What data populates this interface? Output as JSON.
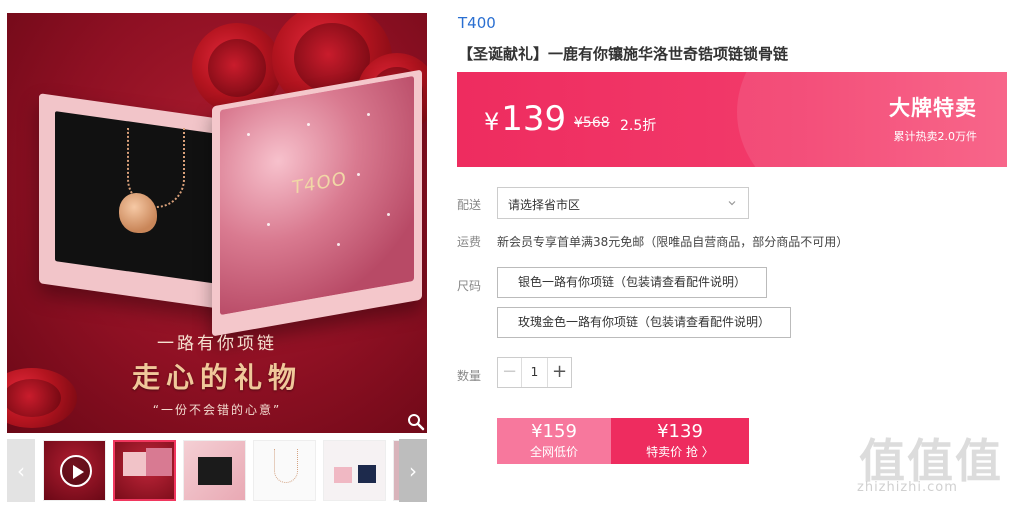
{
  "product": {
    "brand": "T400",
    "title": "【圣诞献礼】一鹿有你镶施华洛世奇锆项链锁骨链",
    "image_caption_line1": "一路有你项链",
    "image_caption_line2": "走心的礼物",
    "image_caption_line3": "“一份不会错的心意”",
    "lid_logo_text": "T4OO"
  },
  "price_banner": {
    "currency": "¥",
    "current_price": "139",
    "original_price": "¥568",
    "discount": "2.5折",
    "promo_title": "大牌特卖",
    "sold_count": "累计热卖2.0万件"
  },
  "delivery": {
    "label": "配送",
    "select_value": "请选择省市区"
  },
  "shipping_fee": {
    "label": "运费",
    "text": "新会员专享首单满38元免邮（限唯品自营商品，部分商品不可用）"
  },
  "size": {
    "label": "尺码",
    "options": [
      "银色一路有你项链（包装请查看配件说明）",
      "玫瑰金色一路有你项链（包装请查看配件说明）"
    ]
  },
  "quantity": {
    "label": "数量",
    "value": "1",
    "minus": "−",
    "plus": "+"
  },
  "cta": {
    "left_price": "¥159",
    "left_label": "全网低价",
    "right_price": "¥139",
    "right_label": "特卖价 抢 〉"
  },
  "thumbnails": {
    "prev": "‹",
    "next": "›"
  },
  "watermark": {
    "glyphs": "值值值",
    "url": "zhizhizhi.com"
  },
  "colors": {
    "accent": "#ee2c5f",
    "accent_light": "#f7789d",
    "brand_link": "#2a6fd1"
  }
}
